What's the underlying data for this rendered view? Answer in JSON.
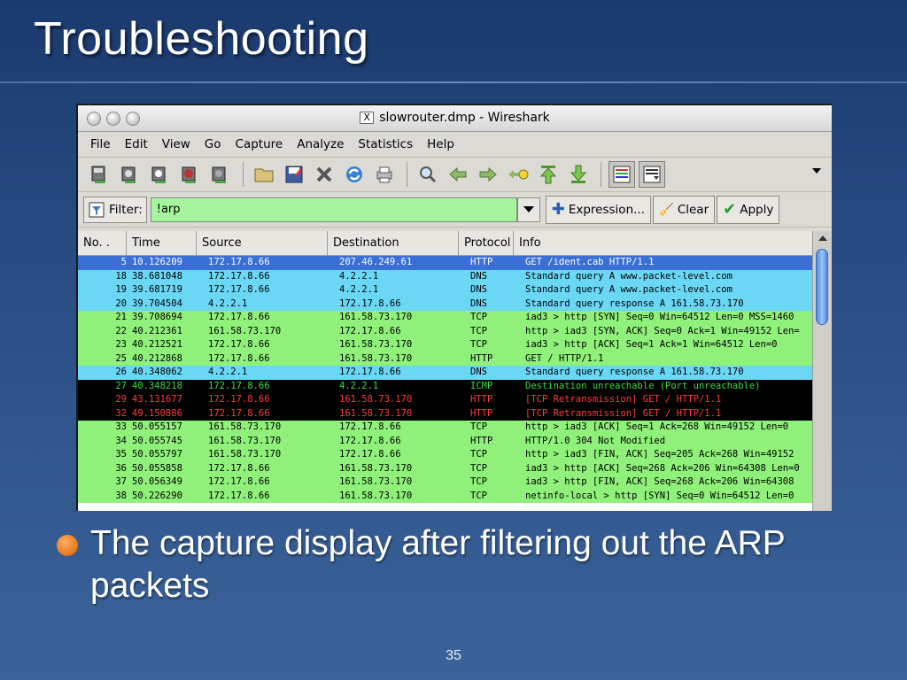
{
  "slide": {
    "title": "Troubleshooting",
    "bullet": "The capture display after filtering out the ARP packets",
    "page_number": "35"
  },
  "window": {
    "title": "slowrouter.dmp - Wireshark",
    "title_icon": "X"
  },
  "menu": [
    "File",
    "Edit",
    "View",
    "Go",
    "Capture",
    "Analyze",
    "Statistics",
    "Help"
  ],
  "filter": {
    "label": "Filter:",
    "value": "!arp",
    "expression_label": "Expression...",
    "clear_label": "Clear",
    "apply_label": "Apply"
  },
  "columns": {
    "no": "No. .",
    "time": "Time",
    "source": "Source",
    "destination": "Destination",
    "protocol": "Protocol",
    "info": "Info"
  },
  "colors": {
    "http": "#8ff07a",
    "dns": "#6ad8f5",
    "selected": "#3a6fd6",
    "black": "#000000",
    "red_text": "#ff3b3b",
    "icmp_text": "#41d941"
  },
  "packets": [
    {
      "no": "5",
      "time": "10.126209",
      "src": "172.17.8.66",
      "dst": "207.46.249.61",
      "proto": "HTTP",
      "info": "GET /ident.cab HTTP/1.1",
      "bg": "#3a6fd6",
      "fg": "#ffffff"
    },
    {
      "no": "18",
      "time": "38.681048",
      "src": "172.17.8.66",
      "dst": "4.2.2.1",
      "proto": "DNS",
      "info": "Standard query A www.packet-level.com",
      "bg": "#6ad8f5",
      "fg": "#000000"
    },
    {
      "no": "19",
      "time": "39.681719",
      "src": "172.17.8.66",
      "dst": "4.2.2.1",
      "proto": "DNS",
      "info": "Standard query A www.packet-level.com",
      "bg": "#6ad8f5",
      "fg": "#000000"
    },
    {
      "no": "20",
      "time": "39.704504",
      "src": "4.2.2.1",
      "dst": "172.17.8.66",
      "proto": "DNS",
      "info": "Standard query response A 161.58.73.170",
      "bg": "#6ad8f5",
      "fg": "#000000"
    },
    {
      "no": "21",
      "time": "39.708694",
      "src": "172.17.8.66",
      "dst": "161.58.73.170",
      "proto": "TCP",
      "info": "iad3 > http [SYN] Seq=0 Win=64512 Len=0 MSS=1460",
      "bg": "#8ff07a",
      "fg": "#000000"
    },
    {
      "no": "22",
      "time": "40.212361",
      "src": "161.58.73.170",
      "dst": "172.17.8.66",
      "proto": "TCP",
      "info": "http > iad3 [SYN, ACK] Seq=0 Ack=1 Win=49152 Len=",
      "bg": "#8ff07a",
      "fg": "#000000"
    },
    {
      "no": "23",
      "time": "40.212521",
      "src": "172.17.8.66",
      "dst": "161.58.73.170",
      "proto": "TCP",
      "info": "iad3 > http [ACK] Seq=1 Ack=1 Win=64512 Len=0",
      "bg": "#8ff07a",
      "fg": "#000000"
    },
    {
      "no": "25",
      "time": "40.212868",
      "src": "172.17.8.66",
      "dst": "161.58.73.170",
      "proto": "HTTP",
      "info": "GET / HTTP/1.1",
      "bg": "#8ff07a",
      "fg": "#000000"
    },
    {
      "no": "26",
      "time": "40.348062",
      "src": "4.2.2.1",
      "dst": "172.17.8.66",
      "proto": "DNS",
      "info": "Standard query response A 161.58.73.170",
      "bg": "#6ad8f5",
      "fg": "#000000"
    },
    {
      "no": "27",
      "time": "40.348218",
      "src": "172.17.8.66",
      "dst": "4.2.2.1",
      "proto": "ICMP",
      "info": "Destination unreachable (Port unreachable)",
      "bg": "#000000",
      "fg": "#41d941"
    },
    {
      "no": "29",
      "time": "43.131677",
      "src": "172.17.8.66",
      "dst": "161.58.73.170",
      "proto": "HTTP",
      "info": "[TCP Retransmission] GET / HTTP/1.1",
      "bg": "#000000",
      "fg": "#ff3b3b"
    },
    {
      "no": "32",
      "time": "49.150886",
      "src": "172.17.8.66",
      "dst": "161.58.73.170",
      "proto": "HTTP",
      "info": "[TCP Retransmission] GET / HTTP/1.1",
      "bg": "#000000",
      "fg": "#ff3b3b"
    },
    {
      "no": "33",
      "time": "50.055157",
      "src": "161.58.73.170",
      "dst": "172.17.8.66",
      "proto": "TCP",
      "info": "http > iad3 [ACK] Seq=1 Ack=268 Win=49152 Len=0",
      "bg": "#8ff07a",
      "fg": "#000000"
    },
    {
      "no": "34",
      "time": "50.055745",
      "src": "161.58.73.170",
      "dst": "172.17.8.66",
      "proto": "HTTP",
      "info": "HTTP/1.0 304 Not Modified",
      "bg": "#8ff07a",
      "fg": "#000000"
    },
    {
      "no": "35",
      "time": "50.055797",
      "src": "161.58.73.170",
      "dst": "172.17.8.66",
      "proto": "TCP",
      "info": "http > iad3 [FIN, ACK] Seq=205 Ack=268 Win=49152",
      "bg": "#8ff07a",
      "fg": "#000000"
    },
    {
      "no": "36",
      "time": "50.055858",
      "src": "172.17.8.66",
      "dst": "161.58.73.170",
      "proto": "TCP",
      "info": "iad3 > http [ACK] Seq=268 Ack=206 Win=64308 Len=0",
      "bg": "#8ff07a",
      "fg": "#000000"
    },
    {
      "no": "37",
      "time": "50.056349",
      "src": "172.17.8.66",
      "dst": "161.58.73.170",
      "proto": "TCP",
      "info": "iad3 > http [FIN, ACK] Seq=268 Ack=206 Win=64308",
      "bg": "#8ff07a",
      "fg": "#000000"
    },
    {
      "no": "38",
      "time": "50.226290",
      "src": "172.17.8.66",
      "dst": "161.58.73.170",
      "proto": "TCP",
      "info": "netinfo-local > http [SYN] Seq=0 Win=64512 Len=0",
      "bg": "#8ff07a",
      "fg": "#000000"
    }
  ]
}
